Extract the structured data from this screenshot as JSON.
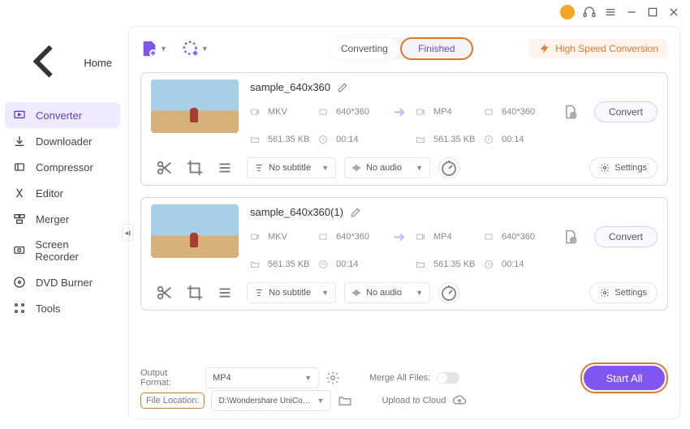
{
  "titlebar": {},
  "sidebar": {
    "home_label": "Home",
    "items": [
      {
        "label": "Converter"
      },
      {
        "label": "Downloader"
      },
      {
        "label": "Compressor"
      },
      {
        "label": "Editor"
      },
      {
        "label": "Merger"
      },
      {
        "label": "Screen Recorder"
      },
      {
        "label": "DVD Burner"
      },
      {
        "label": "Tools"
      }
    ]
  },
  "top": {
    "tab_converting": "Converting",
    "tab_finished": "Finished",
    "high_speed": "High Speed Conversion"
  },
  "files": [
    {
      "name": "sample_640x360",
      "src_fmt": "MKV",
      "src_res": "640*360",
      "src_size": "561.35 KB",
      "src_dur": "00:14",
      "dst_fmt": "MP4",
      "dst_res": "640*360",
      "dst_size": "561.35 KB",
      "dst_dur": "00:14",
      "subtitle": "No subtitle",
      "audio": "No audio",
      "settings": "Settings",
      "convert": "Convert"
    },
    {
      "name": "sample_640x360(1)",
      "src_fmt": "MKV",
      "src_res": "640*360",
      "src_size": "561.35 KB",
      "src_dur": "00:14",
      "dst_fmt": "MP4",
      "dst_res": "640*360",
      "dst_size": "561.35 KB",
      "dst_dur": "00:14",
      "subtitle": "No subtitle",
      "audio": "No audio",
      "settings": "Settings",
      "convert": "Convert"
    }
  ],
  "bottom": {
    "output_format_label": "Output Format:",
    "output_format_value": "MP4",
    "file_location_label": "File Location:",
    "file_location_value": "D:\\Wondershare UniConverter 1",
    "merge_label": "Merge All Files:",
    "upload_label": "Upload to Cloud",
    "start_all": "Start All"
  }
}
